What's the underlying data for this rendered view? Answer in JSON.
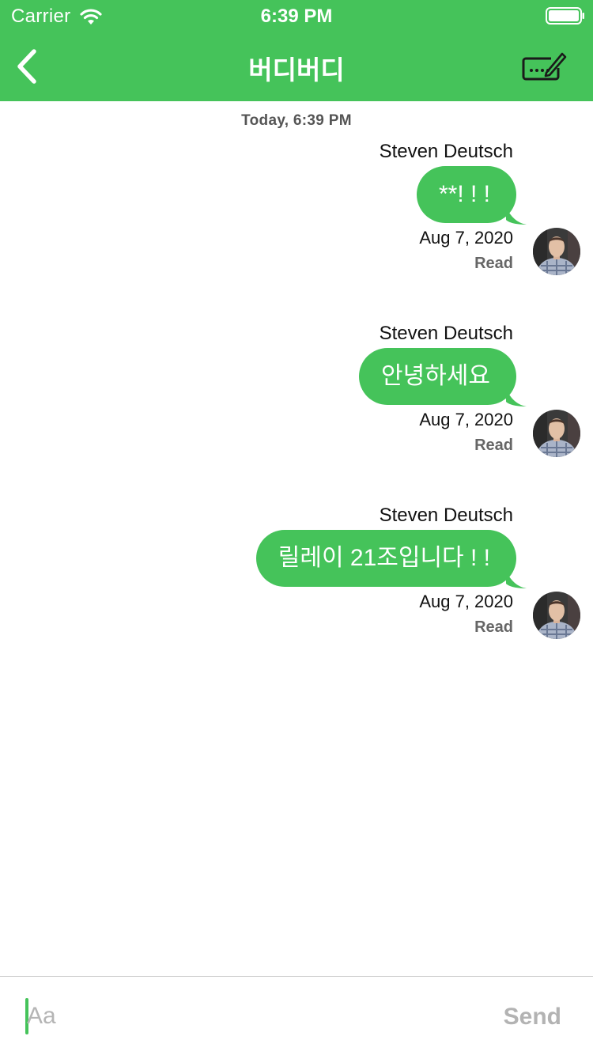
{
  "status_bar": {
    "carrier": "Carrier",
    "time": "6:39 PM",
    "wifi_icon": "wifi-icon",
    "battery_icon": "battery-full-icon"
  },
  "nav": {
    "back_icon": "chevron-left-icon",
    "title": "버디버디",
    "compose_icon": "keyboard-pencil-icon"
  },
  "conversation": {
    "date_header": "Today, 6:39 PM",
    "messages": [
      {
        "sender": "Steven Deutsch",
        "text": "**! ! !",
        "date": "Aug 7, 2020",
        "status": "Read"
      },
      {
        "sender": "Steven Deutsch",
        "text": "안녕하세요",
        "date": "Aug 7, 2020",
        "status": "Read"
      },
      {
        "sender": "Steven Deutsch",
        "text": "릴레이 21조입니다 ! !",
        "date": "Aug 7, 2020",
        "status": "Read"
      }
    ]
  },
  "composer": {
    "placeholder": "Aa",
    "value": "",
    "send_label": "Send"
  },
  "colors": {
    "accent": "#45c35a",
    "bubble_text": "#ffffff",
    "send_disabled": "#b3b3b3",
    "status_text": "#666666"
  }
}
